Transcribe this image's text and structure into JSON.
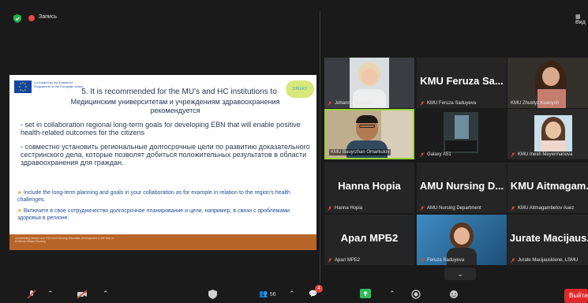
{
  "topbar": {
    "record_label": "Запись",
    "view_label": "Вид"
  },
  "slide": {
    "logo_text": "Co-funded by the Erasmus+ Programme of the European Union",
    "badge_text": "DIREKT",
    "title_en": "5. It is recommended for the MU's and HC institutions to",
    "title_ru": "Медицинским университетам и учреждениям здравоохранения рекомендуется",
    "bullet_en": "- set in collaboration regional long-term goals for developing EBN that will enable positive health-related outcomes for the citizens",
    "bullet_ru": "- совместно установить региональные долгосрочные цели по развитию доказательного сестринского дела, которые позволят добиться положительных результатов в области здравоохранения для граждан.",
    "arrow_en": "Include the long-term planning and goals in your collaboration as for example in relation to the region's health challenges.",
    "arrow_ru": "Включите в свое сотрудничество долгосрочное планирование и цели, например, в связи с проблемами здоровья в регионе.",
    "footer_text": "Accelerating Master and PhD level Nursing Education development in the field of Evidence-Based Nursing"
  },
  "participants": [
    {
      "big": "",
      "label": "Johanna Heikkilä",
      "video": "woman-blonde",
      "muted": true
    },
    {
      "big": "KMU  Feruza Sa...",
      "label": "KMU Feruza Saduyeva",
      "video": "",
      "muted": true
    },
    {
      "big": "",
      "label": "KMU Zhuldyz Kuanysh",
      "video": "woman-dark",
      "muted": false
    },
    {
      "big": "",
      "label": "KMU Bauyrzhan Omarkulov",
      "video": "man-glasses",
      "muted": false,
      "active": true
    },
    {
      "big": "",
      "label": "Galaxy A51",
      "video": "room",
      "muted": true
    },
    {
      "big": "",
      "label": "KMU Inesh Meyermanova",
      "video": "woman-light",
      "muted": true
    },
    {
      "big": "Hanna Hopia",
      "label": "Hanna Hopia",
      "video": "",
      "muted": true
    },
    {
      "big": "AMU Nursing D...",
      "label": "AMU Nursing Department",
      "video": "",
      "muted": true
    },
    {
      "big": "KMU  Aitmagam...",
      "label": "KMU Aitmagambetov Auez",
      "video": "",
      "muted": true
    },
    {
      "big": "Арал МРБ2",
      "label": "Арал МРБ2",
      "video": "",
      "muted": true
    },
    {
      "big": "",
      "label": "Feruza Saduyeva",
      "video": "woman-blue",
      "muted": true
    },
    {
      "big": "Jurate Macijaus...",
      "label": "Jurate Macijauskiene, LSMU",
      "video": "",
      "muted": true
    }
  ],
  "toolbar": {
    "participants_count": "56",
    "chat_badge": "4",
    "leave_label": "Выйти"
  },
  "colors": {
    "active_border": "#9ad33a",
    "muted_mic": "#e0463a",
    "leave": "#e02828",
    "share_green": "#2fbf5a"
  }
}
